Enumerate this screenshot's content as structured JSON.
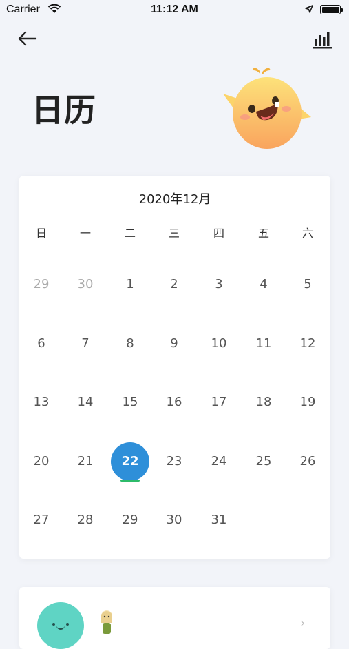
{
  "status_bar": {
    "carrier": "Carrier",
    "time": "11:12 AM"
  },
  "nav": {
    "back_icon": "arrow-left-icon",
    "stats_icon": "bar-chart-icon"
  },
  "page": {
    "title": "日历"
  },
  "calendar": {
    "month_label": "2020年12月",
    "weekdays": [
      "日",
      "一",
      "二",
      "三",
      "四",
      "五",
      "六"
    ],
    "weeks": [
      [
        "29",
        "30",
        "1",
        "2",
        "3",
        "4",
        "5"
      ],
      [
        "6",
        "7",
        "8",
        "9",
        "10",
        "11",
        "12"
      ],
      [
        "13",
        "14",
        "15",
        "16",
        "17",
        "18",
        "19"
      ],
      [
        "20",
        "21",
        "22",
        "23",
        "24",
        "25",
        "26"
      ],
      [
        "27",
        "28",
        "29",
        "30",
        "31",
        "",
        ""
      ]
    ],
    "other_month_days": [
      "29",
      "30"
    ],
    "selected_day": "22",
    "selected_color": "#2e8fd9",
    "today_marker_color": "#2dbb6a"
  },
  "bottom_card": {
    "avatar_icon": "mascot-avatar-icon",
    "chevron_icon": "chevron-right-icon"
  }
}
